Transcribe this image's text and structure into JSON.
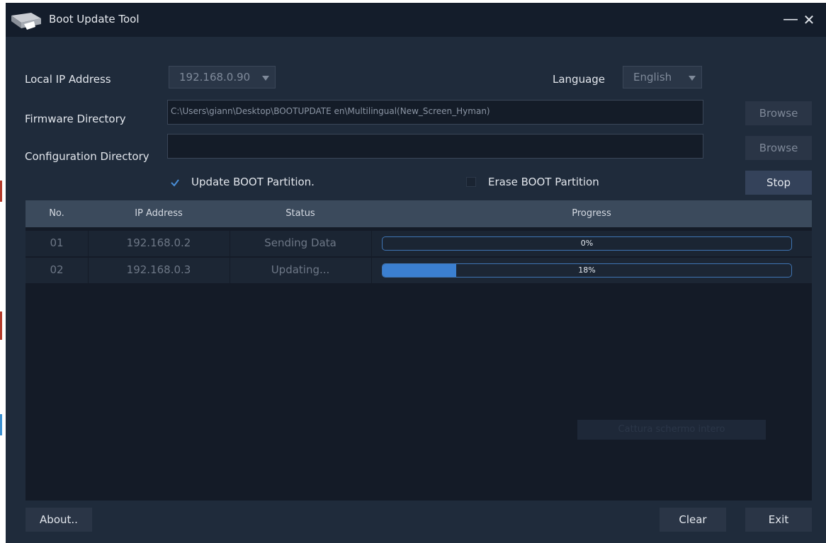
{
  "window": {
    "title": "Boot Update Tool",
    "minimize_glyph": "—",
    "close_glyph": "✕"
  },
  "settings": {
    "local_ip_label": "Local IP Address",
    "local_ip_value": "192.168.0.90",
    "language_label": "Language",
    "language_value": "English",
    "firmware_label": "Firmware Directory",
    "firmware_path": "C:\\Users\\giann\\Desktop\\BOOTUPDATE en\\Multilingual(New_Screen_Hyman)",
    "config_label": "Configuration Directory",
    "config_path": "",
    "browse_label": "Browse",
    "update_boot_label": "Update BOOT Partition.",
    "update_boot_checked": true,
    "erase_boot_label": "Erase BOOT Partition",
    "erase_boot_checked": false,
    "stop_label": "Stop"
  },
  "table": {
    "columns": [
      "No.",
      "IP Address",
      "Status",
      "Progress"
    ],
    "rows": [
      {
        "no": "01",
        "ip": "192.168.0.2",
        "status": "Sending Data",
        "progress": 0,
        "progress_text": "0%"
      },
      {
        "no": "02",
        "ip": "192.168.0.3",
        "status": "Updating...",
        "progress": 18,
        "progress_text": "18%"
      }
    ]
  },
  "overlay": {
    "capture_label": "Cattura schermo intero"
  },
  "footer": {
    "about_label": "About..",
    "clear_label": "Clear",
    "exit_label": "Exit"
  },
  "colors": {
    "accent": "#3b7fd0",
    "window_bg": "#1f2b3b",
    "titlebar_bg": "#141d2b"
  },
  "icons": {
    "logo": "device-logo-icon",
    "minimize": "minimize-icon",
    "close": "close-icon",
    "dropdown": "chevron-down-icon",
    "check": "checkmark-icon"
  }
}
